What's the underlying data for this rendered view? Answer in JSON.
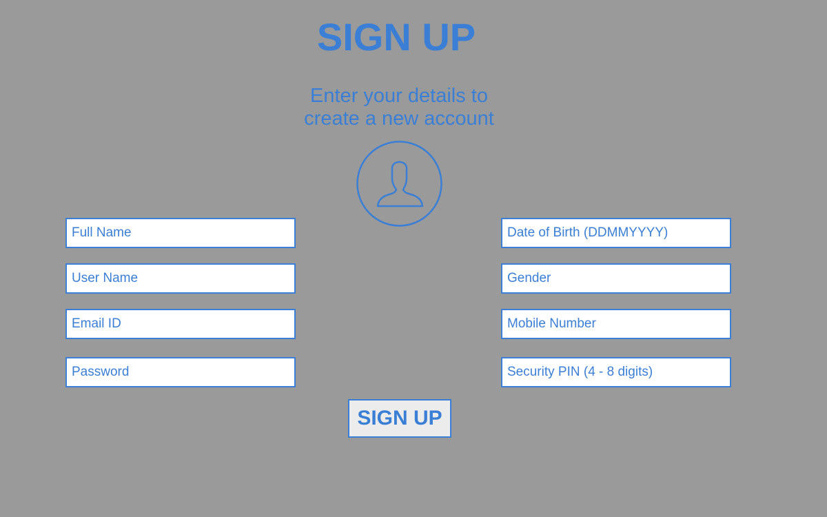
{
  "header": {
    "title": "SIGN UP",
    "subtitle_line1": "Enter your details to",
    "subtitle_line2": "create a new account"
  },
  "avatar": {
    "icon": "user-silhouette-icon"
  },
  "form": {
    "full_name": {
      "placeholder": "Full Name",
      "value": ""
    },
    "user_name": {
      "placeholder": "User Name",
      "value": ""
    },
    "email": {
      "placeholder": "Email ID",
      "value": ""
    },
    "password": {
      "placeholder": "Password",
      "value": ""
    },
    "dob": {
      "placeholder": "Date of Birth (DDMMYYYY)",
      "value": ""
    },
    "gender": {
      "placeholder": "Gender",
      "value": ""
    },
    "mobile": {
      "placeholder": "Mobile Number",
      "value": ""
    },
    "pin": {
      "placeholder": "Security PIN (4 - 8 digits)",
      "value": ""
    },
    "submit_label": "SIGN UP"
  },
  "colors": {
    "background": "#9a9a9a",
    "accent": "#3a7fd5",
    "field_background": "#ffffff",
    "button_background": "#ececec"
  }
}
